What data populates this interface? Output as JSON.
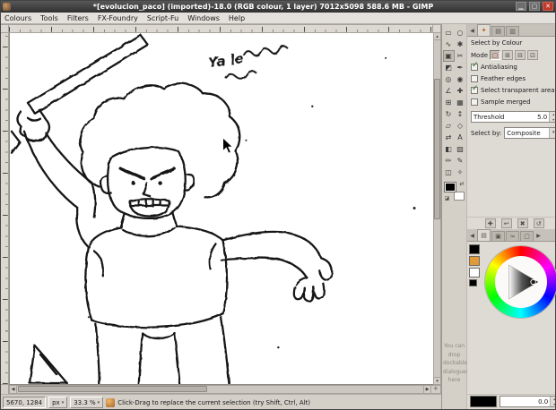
{
  "window": {
    "title": "*[evolucion_paco] (imported)-18.0 (RGB colour, 1 layer) 7012x5098 588.6 MB - GIMP",
    "minimize_glyph": "▁",
    "maximize_glyph": "▢",
    "close_glyph": "✕"
  },
  "glyphs": {
    "up": "▴",
    "down": "▾",
    "left": "◀",
    "right": "▶",
    "menu": "▾",
    "swap": "⇄",
    "reset": "◪",
    "nav": "✛"
  },
  "menubar": {
    "items": [
      "Colours",
      "Tools",
      "Filters",
      "FX-Foundry",
      "Script-Fu",
      "Windows",
      "Help"
    ]
  },
  "canvas": {
    "annotation": "Ya le"
  },
  "toolbox": {
    "tool_glyphs": [
      "▭",
      "○",
      "∿",
      "✱",
      "▣",
      "✂",
      "◩",
      "✒",
      "◎",
      "◉",
      "∠",
      "✚",
      "⊞",
      "▦",
      "↻",
      "↕",
      "▱",
      "◇",
      "⇄",
      "A",
      "◧",
      "▨",
      "✏",
      "✎",
      "◫",
      "✧"
    ],
    "drop_hint": "You can drop dockable dialogues here"
  },
  "docks": {
    "tab_glyphs": [
      "✦",
      "▤",
      "▥"
    ]
  },
  "tool_options": {
    "title": "Select by Colour",
    "mode_label": "Mode",
    "mode_glyphs": [
      "▢",
      "⊞",
      "⊟",
      "⊡"
    ],
    "options": [
      {
        "label": "Antialiasing",
        "check": "✓"
      },
      {
        "label": "Feather edges",
        "check": ""
      },
      {
        "label": "Select transparent areas",
        "check": "✓"
      },
      {
        "label": "Sample merged",
        "check": ""
      }
    ],
    "threshold": {
      "label": "Threshold",
      "value": "5.0"
    },
    "select_by": {
      "label": "Select by:",
      "value": "Composite"
    },
    "footer_glyphs": [
      "✚",
      "↩",
      "✖",
      "↺"
    ]
  },
  "color_dock": {
    "tab_glyphs": [
      "▤",
      "▣",
      "≈",
      "▢"
    ],
    "value": "0.0"
  },
  "statusbar": {
    "position": "5670, 1284",
    "unit": "px",
    "zoom": "33.3 %",
    "message": "Click-Drag to replace the current selection (try Shift, Ctrl, Alt)"
  }
}
